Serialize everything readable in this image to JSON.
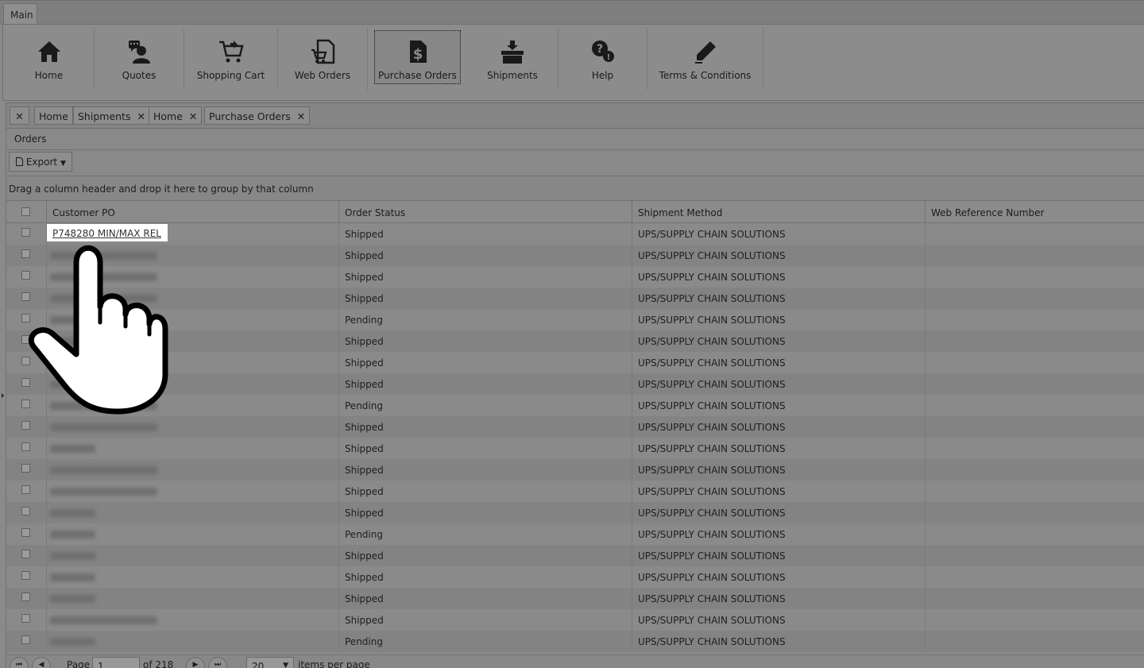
{
  "ribbon": {
    "tab_label": "Main",
    "buttons": [
      {
        "label": "Home",
        "icon": "home-icon"
      },
      {
        "label": "Quotes",
        "icon": "quotes-icon"
      },
      {
        "label": "Shopping Cart",
        "icon": "cart-icon"
      },
      {
        "label": "Web Orders",
        "icon": "web-orders-icon"
      },
      {
        "label": "Purchase Orders",
        "icon": "purchase-orders-icon"
      },
      {
        "label": "Shipments",
        "icon": "shipments-icon"
      },
      {
        "label": "Help",
        "icon": "help-icon"
      },
      {
        "label": "Terms & Conditions",
        "icon": "terms-icon"
      }
    ]
  },
  "doc_tabs": {
    "close_all": "✕",
    "tabs": [
      {
        "label": "Home",
        "closable": false
      },
      {
        "label": "Shipments",
        "closable": true
      },
      {
        "label": "Home",
        "closable": true
      },
      {
        "label": "Purchase Orders",
        "closable": true
      }
    ],
    "close_glyph": "✕"
  },
  "panel": {
    "title": "Orders",
    "export_label": "Export",
    "group_hint": "Drag a column header and drop it here to group by that column"
  },
  "grid": {
    "columns": [
      "Customer PO",
      "Order Status",
      "Shipment Method",
      "Web Reference Number"
    ],
    "rows": [
      {
        "po": "P748280 MIN/MAX REL",
        "status": "Shipped",
        "method": "UPS/SUPPLY CHAIN SOLUTIONS",
        "web_ref": ""
      },
      {
        "po": "",
        "status": "Shipped",
        "method": "UPS/SUPPLY CHAIN SOLUTIONS",
        "web_ref": ""
      },
      {
        "po": "",
        "status": "Shipped",
        "method": "UPS/SUPPLY CHAIN SOLUTIONS",
        "web_ref": ""
      },
      {
        "po": "",
        "status": "Shipped",
        "method": "UPS/SUPPLY CHAIN SOLUTIONS",
        "web_ref": ""
      },
      {
        "po": "",
        "status": "Pending",
        "method": "UPS/SUPPLY CHAIN SOLUTIONS",
        "web_ref": ""
      },
      {
        "po": "",
        "status": "Shipped",
        "method": "UPS/SUPPLY CHAIN SOLUTIONS",
        "web_ref": ""
      },
      {
        "po": "",
        "status": "Shipped",
        "method": "UPS/SUPPLY CHAIN SOLUTIONS",
        "web_ref": ""
      },
      {
        "po": "",
        "status": "Shipped",
        "method": "UPS/SUPPLY CHAIN SOLUTIONS",
        "web_ref": ""
      },
      {
        "po": "",
        "status": "Pending",
        "method": "UPS/SUPPLY CHAIN SOLUTIONS",
        "web_ref": ""
      },
      {
        "po": "",
        "status": "Shipped",
        "method": "UPS/SUPPLY CHAIN SOLUTIONS",
        "web_ref": ""
      },
      {
        "po": "",
        "status": "Shipped",
        "method": "UPS/SUPPLY CHAIN SOLUTIONS",
        "web_ref": ""
      },
      {
        "po": "",
        "status": "Shipped",
        "method": "UPS/SUPPLY CHAIN SOLUTIONS",
        "web_ref": ""
      },
      {
        "po": "",
        "status": "Shipped",
        "method": "UPS/SUPPLY CHAIN SOLUTIONS",
        "web_ref": ""
      },
      {
        "po": "",
        "status": "Shipped",
        "method": "UPS/SUPPLY CHAIN SOLUTIONS",
        "web_ref": ""
      },
      {
        "po": "",
        "status": "Pending",
        "method": "UPS/SUPPLY CHAIN SOLUTIONS",
        "web_ref": ""
      },
      {
        "po": "",
        "status": "Shipped",
        "method": "UPS/SUPPLY CHAIN SOLUTIONS",
        "web_ref": ""
      },
      {
        "po": "",
        "status": "Shipped",
        "method": "UPS/SUPPLY CHAIN SOLUTIONS",
        "web_ref": ""
      },
      {
        "po": "",
        "status": "Shipped",
        "method": "UPS/SUPPLY CHAIN SOLUTIONS",
        "web_ref": ""
      },
      {
        "po": "",
        "status": "Shipped",
        "method": "UPS/SUPPLY CHAIN SOLUTIONS",
        "web_ref": ""
      },
      {
        "po": "",
        "status": "Pending",
        "method": "UPS/SUPPLY CHAIN SOLUTIONS",
        "web_ref": ""
      }
    ]
  },
  "pager": {
    "page_label": "Page",
    "page_value": "1",
    "of_label": "of 218",
    "page_size": "20",
    "items_label": "items per page"
  },
  "colors": {
    "overlay_gray": "#8a8a8a",
    "highlight": "#ffffff"
  }
}
